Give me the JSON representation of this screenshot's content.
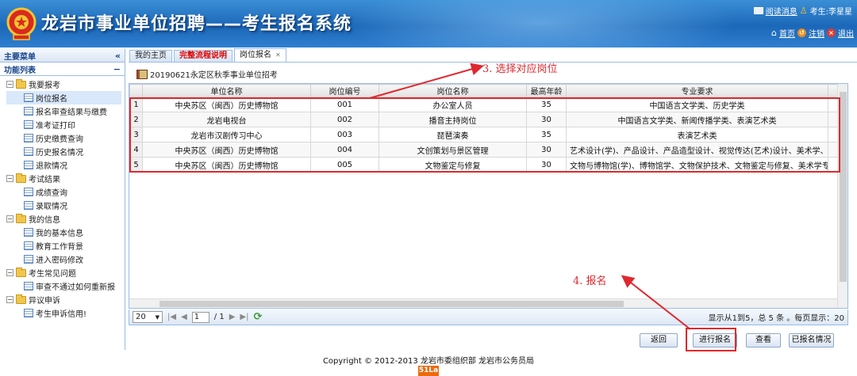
{
  "header": {
    "title": "龙岩市事业单位招聘——考生报名系统",
    "read_message": "阅读消息",
    "user": "考生:李星星",
    "home": "首页",
    "logout": "注销",
    "exit": "退出"
  },
  "sidebar": {
    "main_menu": "主要菜单",
    "collapse": "«",
    "func_list": "功能列表",
    "func_toggle": "−",
    "groups": [
      {
        "label": "我要报考",
        "items": [
          "岗位报名",
          "报名审查结果与缴费",
          "准考证打印",
          "历史缴费查询",
          "历史报名情况",
          "退款情况"
        ]
      },
      {
        "label": "考试结果",
        "items": [
          "成绩查询",
          "录取情况"
        ]
      },
      {
        "label": "我的信息",
        "items": [
          "我的基本信息",
          "教育工作背景",
          "进入密码修改"
        ]
      },
      {
        "label": "考生常见问题",
        "items": [
          "审查不通过如何重新报"
        ]
      },
      {
        "label": "异议申诉",
        "items": [
          "考生申诉信用!"
        ]
      }
    ]
  },
  "tabs": [
    "我的主页",
    "完整流程说明",
    "岗位报名"
  ],
  "panel_title": "20190621永定区秋季事业单位招考",
  "grid": {
    "columns": [
      "单位名称",
      "岗位编号",
      "岗位名称",
      "最高年龄",
      "专业要求"
    ],
    "rows": [
      {
        "n": "1",
        "unit": "中央苏区（闽西）历史博物馆",
        "code": "001",
        "post": "办公室人员",
        "age": "35",
        "major": "中国语言文学类、历史学类"
      },
      {
        "n": "2",
        "unit": "龙岩电视台",
        "code": "002",
        "post": "播音主持岗位",
        "age": "30",
        "major": "中国语言文学类、新闻传播学类、表演艺术类"
      },
      {
        "n": "3",
        "unit": "龙岩市汉剧传习中心",
        "code": "003",
        "post": "琵琶演奏",
        "age": "35",
        "major": "表演艺术类"
      },
      {
        "n": "4",
        "unit": "中央苏区（闽西）历史博物馆",
        "code": "004",
        "post": "文创策划与景区管理",
        "age": "30",
        "major": "艺术设计(学)、产品设计、产品造型设计、视觉传达(艺术)设计、美术学、"
      },
      {
        "n": "5",
        "unit": "中央苏区（闽西）历史博物馆",
        "code": "005",
        "post": "文物鉴定与修复",
        "age": "30",
        "major": "文物与博物馆(学)、博物馆学、文物保护技术、文物鉴定与修复、美术学专"
      }
    ]
  },
  "pager": {
    "page_size": "20",
    "page": "1",
    "total_pages": "/ 1",
    "info": "显示从1到5，总 5 条 。每页显示：20"
  },
  "buttons": {
    "back": "返回",
    "apply": "进行报名",
    "view": "查看",
    "applied": "已报名情况"
  },
  "annotations": {
    "step3": "3. 选择对应岗位",
    "step4": "4. 报名"
  },
  "footer": {
    "copyright": "Copyright © 2012-2013 龙岩市委组织部 龙岩市公务员局",
    "badge": "51La"
  },
  "colors": {
    "header_blue": "#1c67b8",
    "annotation_red": "#e0282e",
    "tab_red": "#dd0000"
  }
}
